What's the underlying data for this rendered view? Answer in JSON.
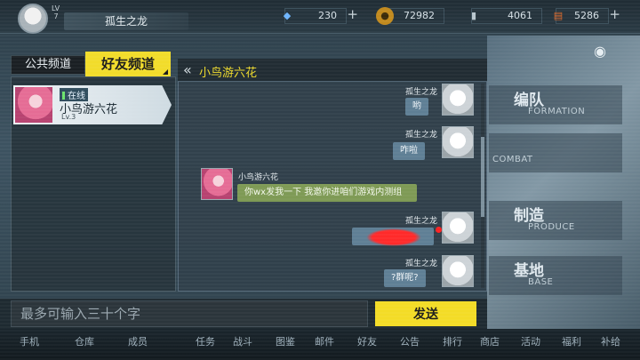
{
  "topbar": {
    "level_label": "LV",
    "level_value": "7",
    "player_name": "孤生之龙",
    "resources": [
      {
        "icon": "diamond-icon",
        "value": "230"
      },
      {
        "icon": "coin-icon",
        "value": "72982"
      },
      {
        "icon": "oil-icon",
        "value": "4061"
      },
      {
        "icon": "ammo-icon",
        "value": "5286"
      }
    ]
  },
  "side_menu": [
    {
      "cn": "编队",
      "en": "FORMATION"
    },
    {
      "cn": "",
      "en": "COMBAT"
    },
    {
      "cn": "制造",
      "en": "PRODUCE"
    },
    {
      "cn": "基地",
      "en": "BASE"
    }
  ],
  "bottom_nav": [
    "手机",
    "仓库",
    "成员",
    "任务",
    "战斗",
    "图鉴",
    "邮件",
    "好友",
    "公告",
    "排行",
    "商店",
    "活动",
    "福利",
    "补给"
  ],
  "tabs": {
    "public": "公共频道",
    "friends": "好友频道"
  },
  "friend_list": [
    {
      "status": "在线",
      "name": "小鸟游六花",
      "level": "Lv.3"
    }
  ],
  "chat": {
    "title": "小鸟游六花",
    "messages": [
      {
        "sender": "孤生之龙",
        "text": "哟",
        "self": true
      },
      {
        "sender": "孤生之龙",
        "text": "咋啦",
        "self": true
      },
      {
        "sender": "小鸟游六花",
        "text": "你wx发我一下 我邀你进咱们游戏内测组",
        "self": false
      },
      {
        "sender": "孤生之龙",
        "text": "",
        "self": true
      },
      {
        "sender": "孤生之龙",
        "text": "?群呢?",
        "self": true
      }
    ]
  },
  "input": {
    "placeholder": "最多可输入三十个字",
    "send_label": "发送"
  }
}
